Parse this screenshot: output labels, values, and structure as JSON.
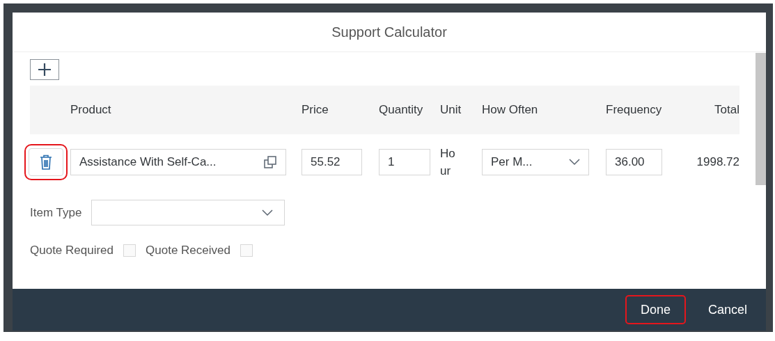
{
  "dialog": {
    "title": "Support Calculator"
  },
  "table": {
    "columns": [
      {
        "label": "Product"
      },
      {
        "label": "Price"
      },
      {
        "label": "Quantity"
      },
      {
        "label": "Unit"
      },
      {
        "label": "How Often"
      },
      {
        "label": "Frequency"
      },
      {
        "label": "Total"
      }
    ],
    "rows": [
      {
        "delete_highlighted": true,
        "product": "Assistance With Self-Ca...",
        "price": "55.52",
        "quantity": "1",
        "unit": "Hour",
        "how_often": "Per M...",
        "frequency": "36.00",
        "total": "1998.72"
      }
    ]
  },
  "item_type": {
    "label": "Item Type"
  },
  "checkboxes": [
    {
      "label": "Quote Required",
      "checked": false
    },
    {
      "label": "Quote Received",
      "checked": false
    }
  ],
  "footer": {
    "buttons": [
      {
        "label": "Done",
        "highlighted": true
      },
      {
        "label": "Cancel",
        "highlighted": false
      }
    ]
  }
}
